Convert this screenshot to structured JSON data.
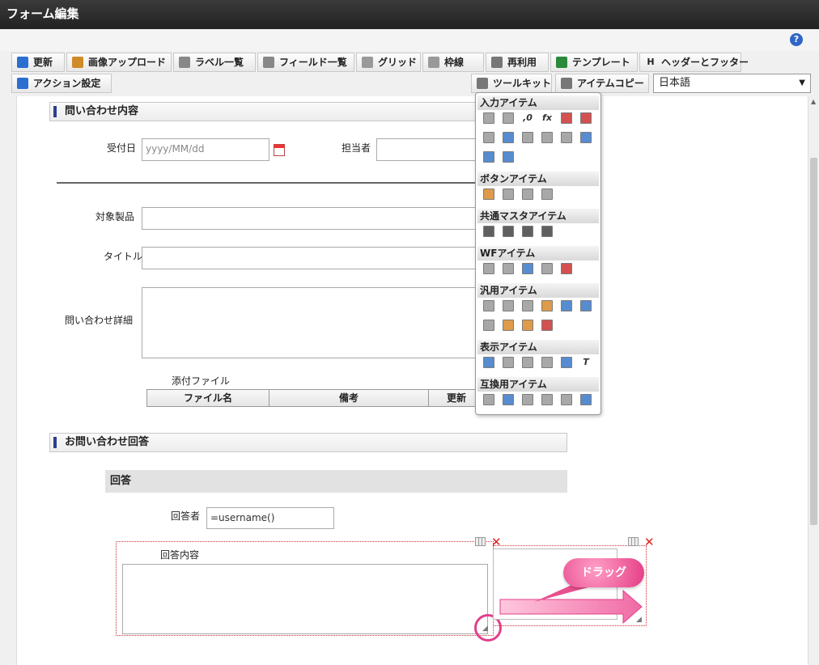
{
  "window": {
    "title": "フォーム編集"
  },
  "help": {
    "label": "?"
  },
  "toolbar": {
    "row1": [
      {
        "label": "更新",
        "icon": "refresh-icon",
        "color": "#2a6fd0"
      },
      {
        "label": "画像アップロード",
        "icon": "image-upload-icon",
        "color": "#d08a2a"
      },
      {
        "label": "ラベル一覧",
        "icon": "label-list-icon",
        "color": "#888888"
      },
      {
        "label": "フィールド一覧",
        "icon": "field-list-icon",
        "color": "#888888"
      },
      {
        "label": "グリッド",
        "icon": "grid-icon",
        "color": "#999999"
      },
      {
        "label": "枠線",
        "icon": "border-icon",
        "color": "#999999"
      },
      {
        "label": "再利用",
        "icon": "reuse-icon",
        "color": "#777777"
      },
      {
        "label": "テンプレート",
        "icon": "template-icon",
        "color": "#2a8a3a"
      },
      {
        "label": "ヘッダーとフッター",
        "icon": "header-footer-icon",
        "color": "#333333"
      }
    ],
    "action_label": "アクション設定",
    "toolkit_label": "ツールキット",
    "itemcopy_label": "アイテムコピー",
    "language": "日本語",
    "header_footer_glyph": "H"
  },
  "form": {
    "section1_title": "問い合わせ内容",
    "receipt_date_label": "受付日",
    "receipt_date_placeholder": "yyyy/MM/dd",
    "assignee_label": "担当者",
    "product_label": "対象製品",
    "title_label": "タイトル",
    "detail_label": "問い合わせ詳細",
    "attachment_label": "添付ファイル",
    "attachment_columns": [
      "ファイル名",
      "備考",
      "更新"
    ],
    "section2_title": "お問い合わせ回答",
    "answer_subtitle": "回答",
    "responder_label": "回答者",
    "responder_value": "=username()",
    "answer_content_label": "回答内容"
  },
  "annotation": {
    "drag_label": "ドラッグ",
    "accent_color": "#e0408a"
  },
  "palette": {
    "groups": [
      {
        "title": "入力アイテム",
        "rows": [
          [
            "textbox-icon",
            "textbox-icon",
            "number-icon",
            "formula-icon",
            "date-icon",
            "datetime-icon"
          ],
          [
            "select-icon",
            "list-icon",
            "checkbox-icon",
            "radio-icon",
            "pulldown-icon",
            "listbox-icon"
          ],
          [
            "file-upload-icon",
            "table-icon"
          ]
        ]
      },
      {
        "title": "ボタンアイテム",
        "rows": [
          [
            "approve-button-icon",
            "next-button-icon",
            "back-button-icon",
            "cancel-button-icon"
          ]
        ]
      },
      {
        "title": "共通マスタアイテム",
        "rows": [
          [
            "user-icon",
            "organization-icon",
            "role-icon",
            "public-group-icon"
          ]
        ]
      },
      {
        "title": "WFアイテム",
        "rows": [
          [
            "clipboard-icon",
            "attach-icon",
            "image-icon",
            "history-icon",
            "stamp-icon"
          ]
        ]
      },
      {
        "title": "汎用アイテム",
        "rows": [
          [
            "separator-icon",
            "document-icon",
            "camera-icon",
            "search-icon",
            "upload-icon",
            "download-icon"
          ],
          [
            "panel-icon",
            "id-card-icon",
            "tree-icon",
            "calendar-icon"
          ]
        ]
      },
      {
        "title": "表示アイテム",
        "rows": [
          [
            "label-icon",
            "hline-icon",
            "vline-icon",
            "box-icon",
            "picture-icon",
            "text-icon"
          ]
        ]
      },
      {
        "title": "互換用アイテム",
        "rows": [
          [
            "select-icon",
            "list-icon",
            "checkbox-icon",
            "radio-icon",
            "pulldown-icon",
            "listbox-icon"
          ]
        ]
      }
    ],
    "icon_colors": {
      "blue": "#3a78c8",
      "gray": "#9a9a9a",
      "green": "#3c9a4a",
      "orange": "#d98a2a",
      "red": "#cc3333",
      "dark": "#444444"
    },
    "text_glyphs": {
      "number-icon": ",0",
      "formula-icon": "fx",
      "text-icon": "T"
    }
  }
}
